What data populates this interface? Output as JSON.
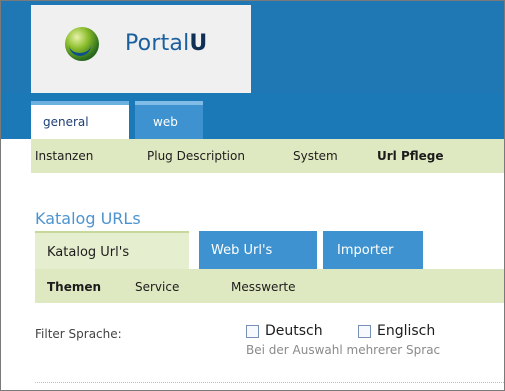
{
  "logo": {
    "text_regular": "Portal",
    "text_bold": "U"
  },
  "main_tabs": [
    {
      "label": "general",
      "active": true
    },
    {
      "label": "web",
      "active": false
    }
  ],
  "subnav": [
    {
      "label": "Instanzen"
    },
    {
      "label": "Plug Description"
    },
    {
      "label": "System"
    },
    {
      "label": "Url Pflege",
      "active": true
    }
  ],
  "section": {
    "title": "Katalog URLs"
  },
  "section_tabs": [
    {
      "label": "Katalog Url's",
      "active": true
    },
    {
      "label": "Web Url's",
      "active": false
    },
    {
      "label": "Importer",
      "active": false
    }
  ],
  "section_subnav": [
    {
      "label": "Themen",
      "active": true
    },
    {
      "label": "Service"
    },
    {
      "label": "Messwerte"
    }
  ],
  "filter": {
    "label": "Filter Sprache:",
    "options": [
      {
        "label": "Deutsch",
        "checked": false
      },
      {
        "label": "Englisch",
        "checked": false
      }
    ],
    "hint": "Bei der Auswahl mehrerer Sprac"
  },
  "colors": {
    "header_blue": "#1f78b4",
    "tab_blue": "#3e92cf",
    "subnav_green": "#dfe9c1",
    "section_title": "#4d94cf"
  }
}
